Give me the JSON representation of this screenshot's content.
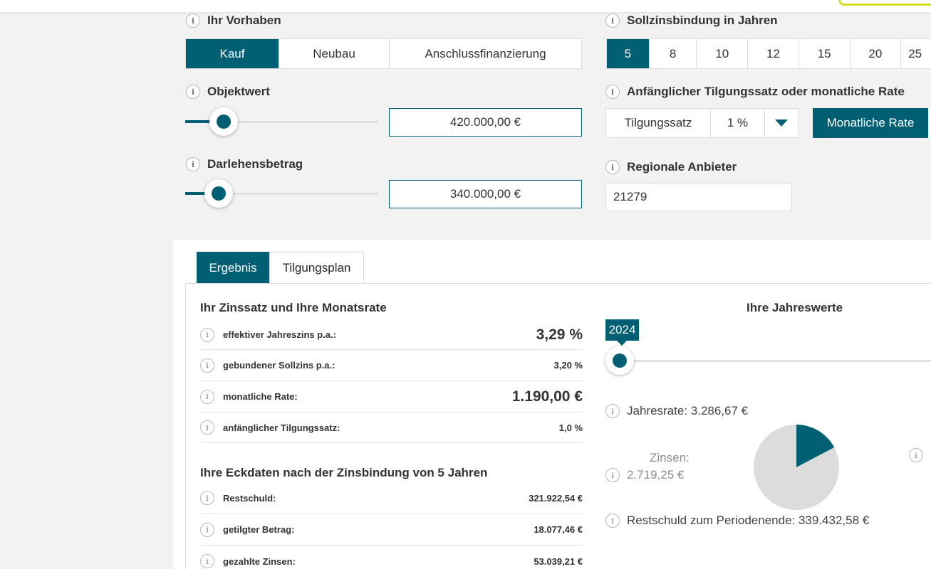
{
  "header": {
    "accent_color": "#d7df23"
  },
  "colors": {
    "primary": "#005f73",
    "pie_rest": "#dcdcdc"
  },
  "vorhaben": {
    "label": "Ihr Vorhaben",
    "options": [
      "Kauf",
      "Neubau",
      "Anschlussfinanzierung"
    ],
    "selected": "Kauf"
  },
  "sollzinsbindung": {
    "label": "Sollzinsbindung in Jahren",
    "options": [
      "5",
      "8",
      "10",
      "12",
      "15",
      "20",
      "25"
    ],
    "selected": "5"
  },
  "objektwert": {
    "label": "Objektwert",
    "value": "420.000,00 €"
  },
  "tilgung": {
    "label": "Anfänglicher Tilgungssatz oder monatliche Rate",
    "option_label": "Tilgungssatz",
    "percent_value": "1 %",
    "rate_button": "Monatliche Rate"
  },
  "darlehen": {
    "label": "Darlehensbetrag",
    "value": "340.000,00 €"
  },
  "regional": {
    "label": "Regionale Anbieter",
    "plz": "21279"
  },
  "result_tabs": {
    "ergebnis": "Ergebnis",
    "tilgungsplan": "Tilgungsplan"
  },
  "zins": {
    "title": "Ihr Zinssatz und Ihre Monatsrate",
    "rows": [
      {
        "label": "effektiver Jahreszins p.a.:",
        "value": "3,29 %"
      },
      {
        "label": "gebundener Sollzins p.a.:",
        "value": "3,20 %"
      },
      {
        "label": "monatliche Rate:",
        "value": "1.190,00 €"
      },
      {
        "label": "anfänglicher Tilgungssatz:",
        "value": "1,0 %"
      }
    ]
  },
  "eckdaten": {
    "title": "Ihre Eckdaten nach der Zinsbindung von 5 Jahren",
    "rows": [
      {
        "label": "Restschuld:",
        "value": "321.922,54 €"
      },
      {
        "label": "getilgter Betrag:",
        "value": "18.077,46 €"
      },
      {
        "label": "gezahlte Zinsen:",
        "value": "53.039,21 €"
      }
    ]
  },
  "jahreswerte": {
    "title": "Ihre Jahreswerte",
    "year": "2024",
    "jahresrate": "Jahresrate: 3.286,67 €",
    "zinsen_label": "Zinsen:",
    "zinsen_value": "2.719,25 €",
    "restschuld": "Restschuld zum Periodenende: 339.432,58 €",
    "tilgung_share": 0.1727
  }
}
